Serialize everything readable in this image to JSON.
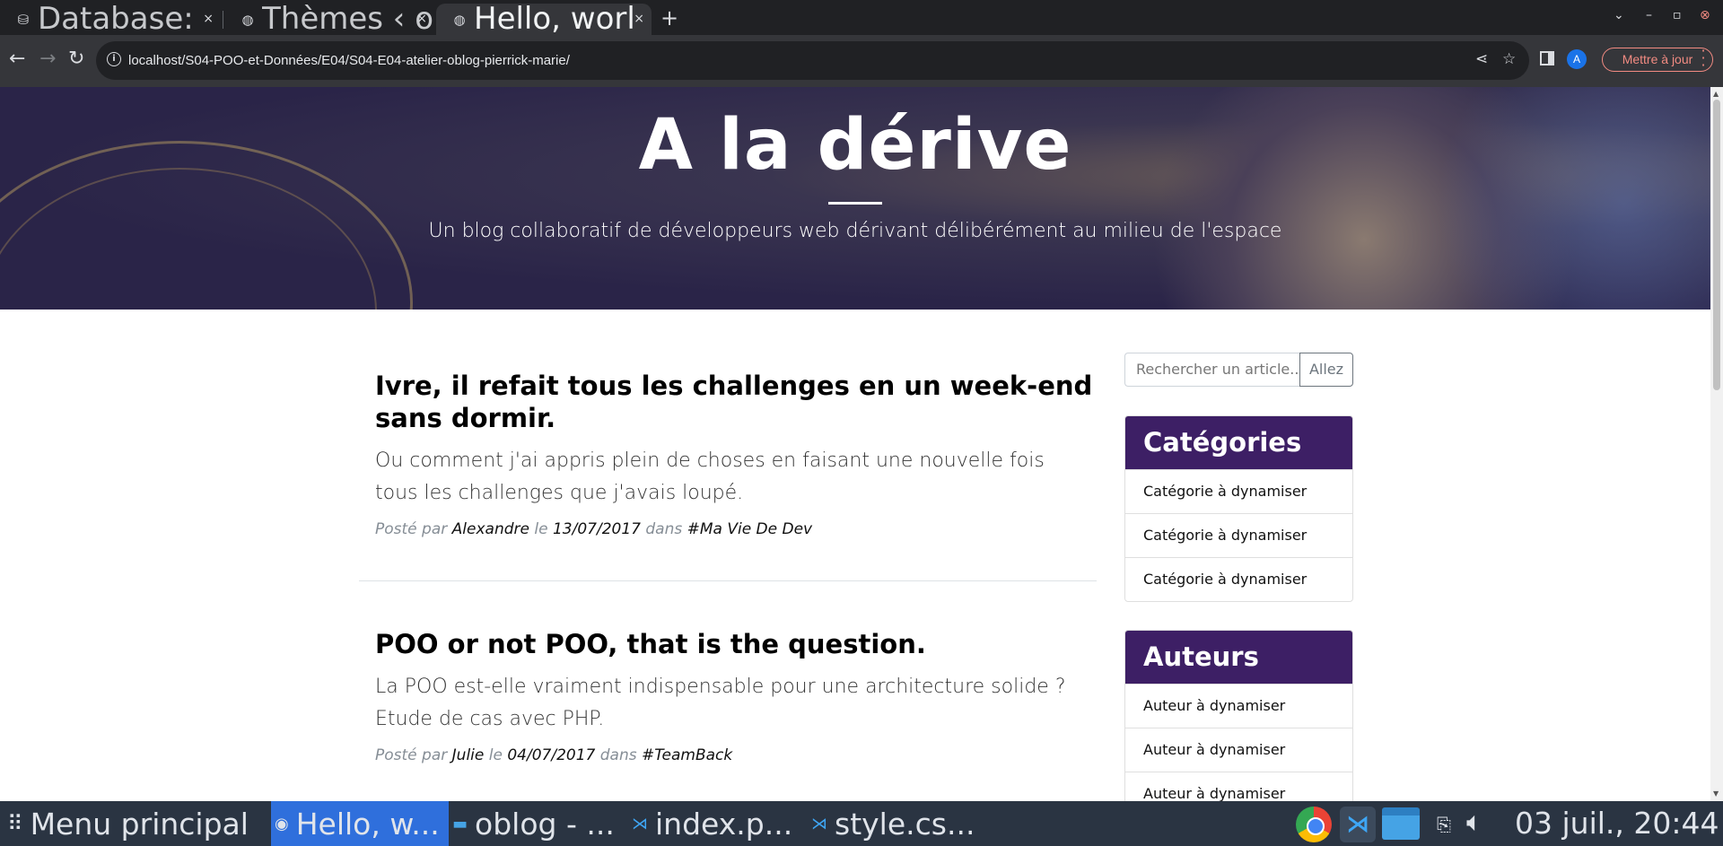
{
  "browser": {
    "tabs": [
      {
        "title": "Database:",
        "favicon": "database-icon",
        "active": false
      },
      {
        "title": "Thèmes ‹ o",
        "favicon": "globe-icon",
        "active": false
      },
      {
        "title": "Hello, worl",
        "favicon": "globe-icon",
        "active": true
      }
    ],
    "close_glyph": "×",
    "new_tab_glyph": "+",
    "url": "localhost/S04-POO-et-Données/E04/S04-E04-atelier-oblog-pierrick-marie/",
    "profile_initial": "A",
    "update_label": "Mettre à jour"
  },
  "blog": {
    "title": "A la dérive",
    "subtitle": "Un blog collaboratif de développeurs web dérivant délibérément au milieu de l'espace",
    "posts": [
      {
        "title": "Ivre, il refait tous les challenges en un week-end sans dormir.",
        "excerpt": "Ou comment j'ai appris plein de choses en faisant une nouvelle fois tous les challenges que j'avais loupé.",
        "meta_posted": "Posté par",
        "author": "Alexandre",
        "meta_on": "le",
        "date": "13/07/2017",
        "meta_in": "dans",
        "category": "#Ma Vie De Dev"
      },
      {
        "title": "POO or not POO, that is the question.",
        "excerpt": "La POO est-elle vraiment indispensable pour une architecture solide ? Etude de cas avec PHP.",
        "meta_posted": "Posté par",
        "author": "Julie",
        "meta_on": "le",
        "date": "04/07/2017",
        "meta_in": "dans",
        "category": "#TeamBack"
      }
    ],
    "search": {
      "placeholder": "Rechercher un article...",
      "button": "Allez"
    },
    "categories": {
      "title": "Catégories",
      "items": [
        "Catégorie à dynamiser",
        "Catégorie à dynamiser",
        "Catégorie à dynamiser"
      ]
    },
    "authors": {
      "title": "Auteurs",
      "items": [
        "Auteur à dynamiser",
        "Auteur à dynamiser",
        "Auteur à dynamiser"
      ]
    },
    "colors": {
      "card_header": "#3d1f65",
      "hero_bg": "#2c2748"
    }
  },
  "taskbar": {
    "menu_label": "Menu principal",
    "windows": [
      {
        "label": "Hello, w...",
        "icon": "chrome-icon",
        "active": true
      },
      {
        "label": "oblog - ...",
        "icon": "folder-icon",
        "active": false
      },
      {
        "label": "index.p...",
        "icon": "vscode-icon",
        "active": false
      },
      {
        "label": "style.cs...",
        "icon": "vscode-icon",
        "active": false
      }
    ],
    "clock": "03 juil., 20:44"
  }
}
